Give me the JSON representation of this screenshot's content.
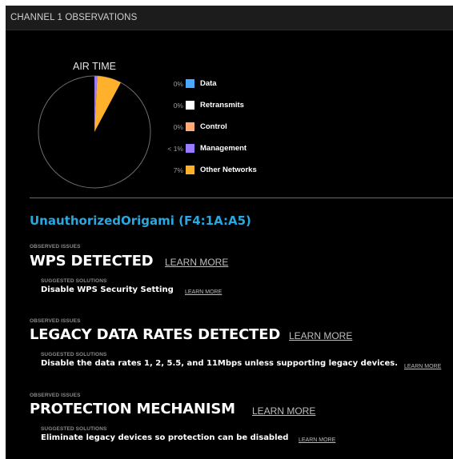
{
  "header": {
    "title": "CHANNEL 1 OBSERVATIONS"
  },
  "air_time": {
    "title": "AIR TIME",
    "legend": [
      {
        "pct": "0%",
        "label": "Data",
        "color": "#4aa8ff",
        "fraction": 0.0
      },
      {
        "pct": "0%",
        "label": "Retransmits",
        "color": "#ffffff",
        "fraction": 0.0
      },
      {
        "pct": "0%",
        "label": "Control",
        "color": "#ffaa77",
        "fraction": 0.0
      },
      {
        "pct": "< 1%",
        "label": "Management",
        "color": "#9a7bff",
        "fraction": 0.008
      },
      {
        "pct": "7%",
        "label": "Other Networks",
        "color": "#ffb12b",
        "fraction": 0.07
      }
    ]
  },
  "network": {
    "name": "UnauthorizedOrigami (F4:1A:A5)",
    "color": "#29a8e0"
  },
  "issues": [
    {
      "observed_label": "OBSERVED ISSUES",
      "title": "WPS DETECTED",
      "learn_more": "LEARN MORE",
      "suggested_label": "SUGGESTED SOLUTIONS",
      "solution": "Disable WPS Security Setting",
      "solution_learn_more": "LEARN MORE"
    },
    {
      "observed_label": "OBSERVED ISSUES",
      "title": "LEGACY DATA RATES DETECTED",
      "learn_more": "LEARN MORE",
      "suggested_label": "SUGGESTED SOLUTIONS",
      "solution": "Disable the data rates 1, 2, 5.5, and 11Mbps unless supporting legacy devices.",
      "solution_learn_more": "LEARN MORE"
    },
    {
      "observed_label": "OBSERVED ISSUES",
      "title": "PROTECTION MECHANISM",
      "learn_more": "LEARN MORE",
      "suggested_label": "SUGGESTED SOLUTIONS",
      "solution": "Eliminate legacy devices so protection can be disabled",
      "solution_learn_more": "LEARN MORE"
    }
  ],
  "chart_data": {
    "type": "pie",
    "title": "AIR TIME",
    "categories": [
      "Data",
      "Retransmits",
      "Control",
      "Management",
      "Other Networks"
    ],
    "values": [
      0,
      0,
      0,
      0.8,
      7
    ],
    "colors": [
      "#4aa8ff",
      "#ffffff",
      "#ffaa77",
      "#9a7bff",
      "#ffb12b"
    ],
    "legend": "right"
  }
}
